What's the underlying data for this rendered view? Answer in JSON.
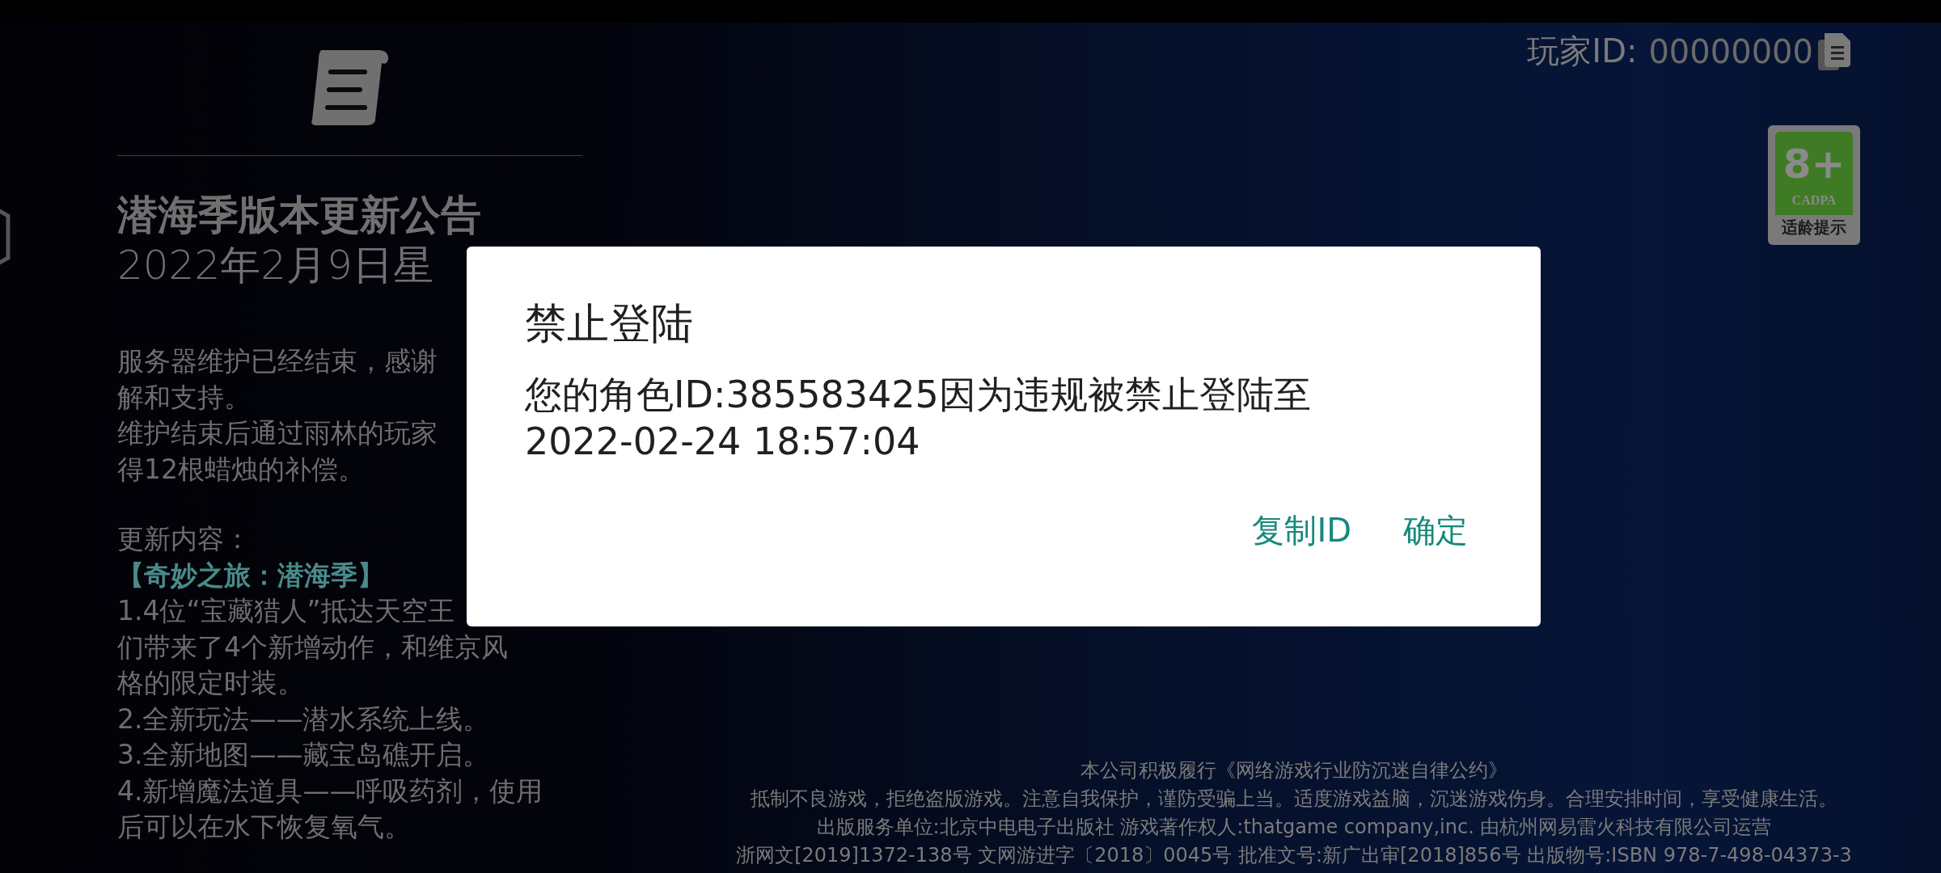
{
  "announcement": {
    "title": "潜海季版本更新公告",
    "date": "2022年2月9日星",
    "blocks": [
      {
        "lines": [
          {
            "text": "服务器维护已经结束，感谢",
            "kind": "plain"
          },
          {
            "text": "解和支持。",
            "kind": "plain"
          },
          {
            "text": "维护结束后通过雨林的玩家",
            "kind": "plain"
          },
          {
            "text": "得12根蜡烛的补偿。",
            "kind": "plain"
          }
        ]
      },
      {
        "lines": [
          {
            "text": "更新内容：",
            "kind": "plain"
          },
          {
            "text": "【奇妙之旅：潜海季】",
            "kind": "heading"
          },
          {
            "text": "1.4位“宝藏猎人”抵达天空王",
            "kind": "plain"
          },
          {
            "text": "们带来了4个新增动作，和维京风",
            "kind": "plain"
          },
          {
            "text": "格的限定时装。",
            "kind": "plain"
          },
          {
            "text": "2.全新玩法——潜水系统上线。",
            "kind": "plain"
          },
          {
            "text": "3.全新地图——藏宝岛礁开启。",
            "kind": "plain"
          },
          {
            "text": "4.新增魔法道具——呼吸药剂，使用",
            "kind": "plain"
          },
          {
            "text": "后可以在水下恢复氧气。",
            "kind": "plain"
          }
        ]
      }
    ]
  },
  "player_id": {
    "label": "玩家ID:",
    "value": "00000000"
  },
  "age_badge": {
    "rating": "8+",
    "org": "CADPA",
    "caption": "适龄提示"
  },
  "dialog": {
    "title": "禁止登陆",
    "message": "您的角色ID:385583425因为违规被禁止登陆至\n2022-02-24 18:57:04",
    "buttons": [
      {
        "label": "复制ID"
      },
      {
        "label": "确定"
      }
    ]
  },
  "footer": [
    "本公司积极履行《网络游戏行业防沉迷自律公约》",
    "抵制不良游戏，拒绝盗版游戏。注意自我保护，谨防受骗上当。适度游戏益脑，沉迷游戏伤身。合理安排时间，享受健康生活。",
    "出版服务单位:北京中电电子出版社 游戏著作权人:thatgame company,inc. 由杭州网易雷火科技有限公司运营",
    "浙网文[2019]1372-138号 文网游进字〔2018〕0045号 批准文号:新广出审[2018]856号 出版物号:ISBN 978-7-498-04373-3"
  ]
}
